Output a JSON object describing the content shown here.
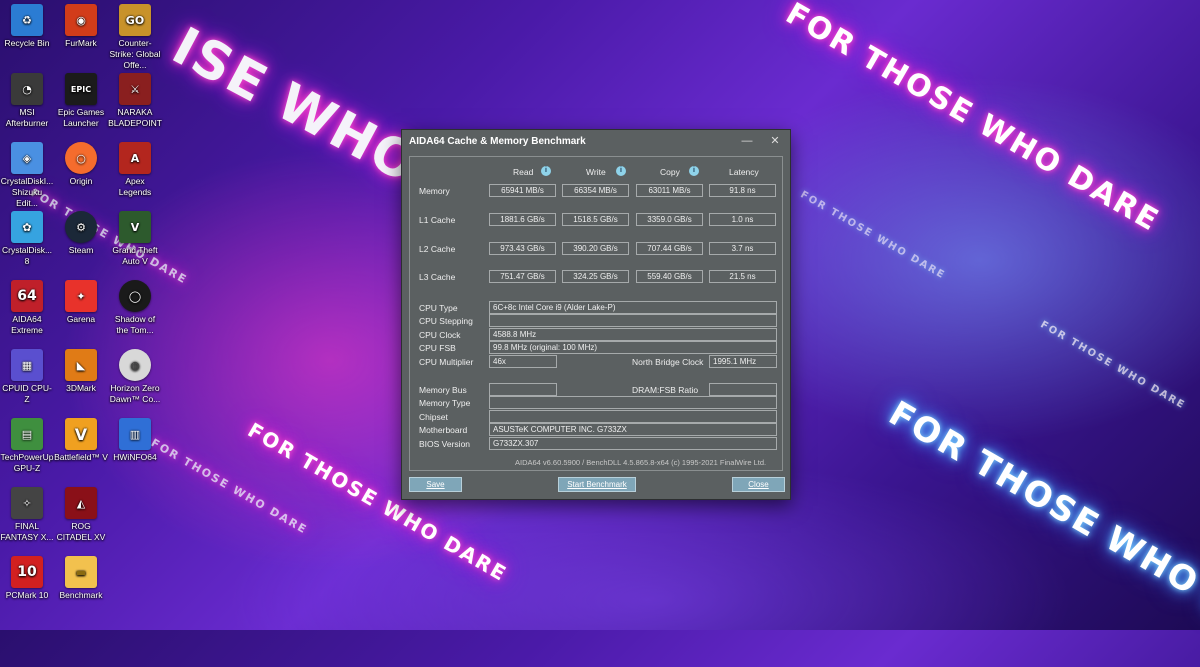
{
  "wallpaper": {
    "slogan": "FOR THOSE WHO DARE",
    "slogan_alt": "ISE WHO DARE"
  },
  "desktop_icons": [
    {
      "label": "Recycle Bin",
      "icon": "recycle-bin-icon",
      "color": "#2b7cd3"
    },
    {
      "label": "FurMark",
      "icon": "furmark-icon",
      "color": "#d23c1a"
    },
    {
      "label": "Counter-Strike: Global Offe...",
      "icon": "csgo-icon",
      "color": "#c8922a"
    },
    {
      "label": "MSI Afterburner",
      "icon": "msi-afterburner-icon",
      "color": "#3a3a3a"
    },
    {
      "label": "Epic Games Launcher",
      "icon": "epic-games-icon",
      "color": "#1b1b1b"
    },
    {
      "label": "NARAKA BLADEPOINT",
      "icon": "naraka-icon",
      "color": "#8a1f1f"
    },
    {
      "label": "CrystalDiskI... Shizuku Edit...",
      "icon": "crystaldiskinfo-icon",
      "color": "#4a90e2"
    },
    {
      "label": "Origin",
      "icon": "origin-icon",
      "color": "#f56c2d"
    },
    {
      "label": "Apex Legends",
      "icon": "apex-legends-icon",
      "color": "#b3261e"
    },
    {
      "label": "CrystalDisk... 8",
      "icon": "crystaldiskmark-icon",
      "color": "#36a3e0"
    },
    {
      "label": "Steam",
      "icon": "steam-icon",
      "color": "#1b2838"
    },
    {
      "label": "Grand Theft Auto V",
      "icon": "gta-v-icon",
      "color": "#2d5a2d"
    },
    {
      "label": "AIDA64 Extreme",
      "icon": "aida64-icon",
      "color": "#c0202a"
    },
    {
      "label": "Garena",
      "icon": "garena-icon",
      "color": "#e8322b"
    },
    {
      "label": "Shadow of the Tom...",
      "icon": "shadow-tomb-raider-icon",
      "color": "#1a1a1a"
    },
    {
      "label": "CPUID CPU-Z",
      "icon": "cpu-z-icon",
      "color": "#5a4fcf"
    },
    {
      "label": "3DMark",
      "icon": "3dmark-icon",
      "color": "#e07b16"
    },
    {
      "label": "Horizon Zero Dawn™ Co...",
      "icon": "horizon-zero-dawn-icon",
      "color": "#d8d8d8"
    },
    {
      "label": "TechPowerUp GPU-Z",
      "icon": "gpu-z-icon",
      "color": "#3f8f3f"
    },
    {
      "label": "Battlefield™ V",
      "icon": "battlefield-icon",
      "color": "#f0a020"
    },
    {
      "label": "HWiNFO64",
      "icon": "hwinfo-icon",
      "color": "#2f6fd6"
    },
    {
      "label": "FINAL FANTASY X...",
      "icon": "final-fantasy-icon",
      "color": "#444"
    },
    {
      "label": "ROG CITADEL XV",
      "icon": "rog-citadel-icon",
      "color": "#8a1018"
    },
    {
      "label": "PCMark 10",
      "icon": "pcmark-icon",
      "color": "#d22020"
    },
    {
      "label": "Benchmark",
      "icon": "folder-icon",
      "color": "#f2c14e"
    }
  ],
  "icon_glyphs": {
    "aida": "64",
    "pcmark": "10",
    "epic": "EPIC",
    "go": "GO",
    "apex": "A",
    "battlefield": "V"
  },
  "window": {
    "title": "AIDA64 Cache & Memory Benchmark",
    "minimize": "—",
    "close": "✕",
    "columns": {
      "read": "Read",
      "write": "Write",
      "copy": "Copy",
      "latency": "Latency"
    },
    "info_glyph": "i",
    "bench_rows": [
      {
        "label": "Memory",
        "read": "65941 MB/s",
        "write": "66354 MB/s",
        "copy": "63011 MB/s",
        "latency": "91.8 ns"
      },
      {
        "label": "L1 Cache",
        "read": "1881.6 GB/s",
        "write": "1518.5 GB/s",
        "copy": "3359.0 GB/s",
        "latency": "1.0 ns"
      },
      {
        "label": "L2 Cache",
        "read": "973.43 GB/s",
        "write": "390.20 GB/s",
        "copy": "707.44 GB/s",
        "latency": "3.7 ns"
      },
      {
        "label": "L3 Cache",
        "read": "751.47 GB/s",
        "write": "324.25 GB/s",
        "copy": "559.40 GB/s",
        "latency": "21.5 ns"
      }
    ],
    "cpu": {
      "type_label": "CPU Type",
      "type_value": "6C+8c Intel Core i9  (Alder Lake-P)",
      "stepping_label": "CPU Stepping",
      "stepping_value": "",
      "clock_label": "CPU Clock",
      "clock_value": "4588.8 MHz",
      "fsb_label": "CPU FSB",
      "fsb_value": "99.8 MHz  (original: 100 MHz)",
      "multiplier_label": "CPU Multiplier",
      "multiplier_value": "46x",
      "nb_clock_label": "North Bridge Clock",
      "nb_clock_value": "1995.1 MHz"
    },
    "system": {
      "membus_label": "Memory Bus",
      "membus_value": "",
      "dram_ratio_label": "DRAM:FSB Ratio",
      "dram_ratio_value": "",
      "memtype_label": "Memory Type",
      "memtype_value": "",
      "chipset_label": "Chipset",
      "chipset_value": "",
      "motherboard_label": "Motherboard",
      "motherboard_value": "ASUSTeK COMPUTER INC. G733ZX",
      "bios_label": "BIOS Version",
      "bios_value": "G733ZX.307"
    },
    "footer": "AIDA64 v6.60.5900 / BenchDLL 4.5.865.8-x64  (c) 1995-2021 FinalWire Ltd.",
    "buttons": {
      "save": "Save",
      "start": "Start Benchmark",
      "close": "Close"
    }
  }
}
